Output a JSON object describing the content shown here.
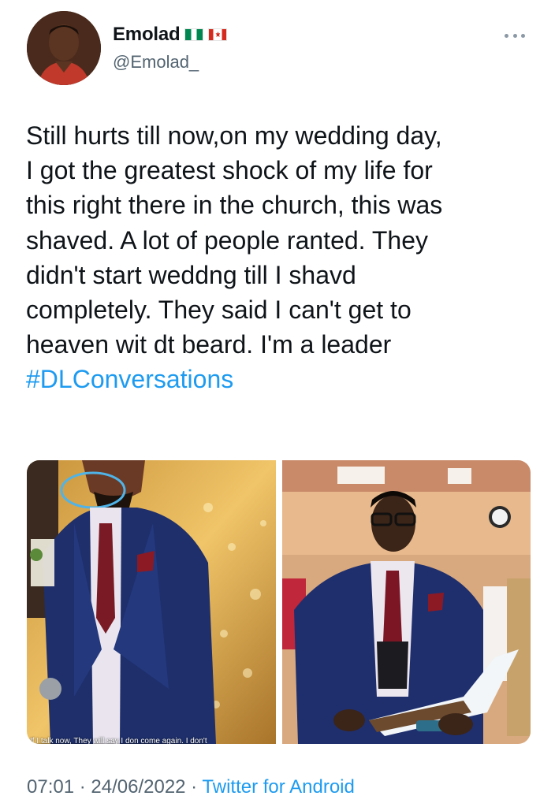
{
  "author": {
    "display_name": "Emolad",
    "handle": "@Emolad_",
    "flags": [
      "nigeria-flag-icon",
      "canada-flag-icon"
    ]
  },
  "tweet": {
    "text": "Still hurts till now,on my wedding day,\nI got the greatest shock of my life for\nthis right there in the church, this was\nshaved. A lot of people ranted. They\ndidn't start weddng till I shavd\ncompletely. They said I can't get to\nheaven wit dt beard. I'm a leader",
    "hashtag": "#DLConversations"
  },
  "media": {
    "left_caption": "If I talk now, They will say I don come again. I don't"
  },
  "meta": {
    "time": "07:01",
    "separator": " · ",
    "date": "24/06/2022",
    "source": "Twitter for Android"
  },
  "colors": {
    "link": "#1d9bf0",
    "secondary_text": "#536471",
    "primary_text": "#0f1419"
  }
}
